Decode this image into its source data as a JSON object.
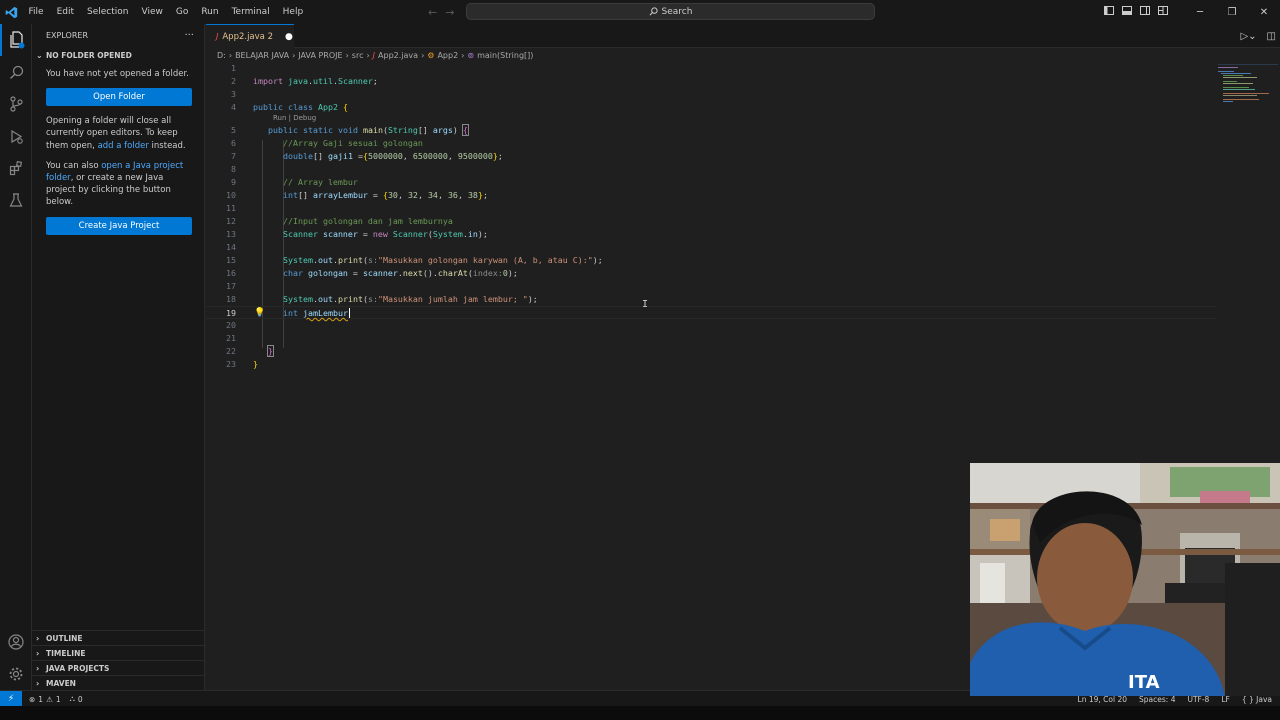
{
  "titlebar": {
    "menu": [
      "File",
      "Edit",
      "Selection",
      "View",
      "Go",
      "Run",
      "Terminal",
      "Help"
    ],
    "search_placeholder": "Search"
  },
  "sidebar": {
    "title": "EXPLORER",
    "section": "NO FOLDER OPENED",
    "msg1": "You have not yet opened a folder.",
    "open_folder_btn": "Open Folder",
    "msg2_a": "Opening a folder will close all currently open editors. To keep them open, ",
    "msg2_link": "add a folder",
    "msg2_b": " instead.",
    "msg3_a": "You can also ",
    "msg3_link": "open a Java project folder",
    "msg3_b": ", or create a new Java project by clicking the button below.",
    "create_java_btn": "Create Java Project",
    "bottom_sections": [
      "OUTLINE",
      "TIMELINE",
      "JAVA PROJECTS",
      "MAVEN"
    ]
  },
  "tab": {
    "icon": "J",
    "label": "App2.java 2"
  },
  "breadcrumb": {
    "parts": [
      "D:",
      "BELAJAR JAVA",
      "JAVA PROJE",
      "src"
    ],
    "file": "App2.java",
    "class": "App2",
    "method": "main(String[])"
  },
  "editor": {
    "codelens": "Run | Debug",
    "current_line": 19,
    "line_count": 23
  },
  "statusbar": {
    "errors": "1",
    "warnings": "1",
    "ports": "0",
    "position": "Ln 19, Col 20",
    "spaces": "Spaces: 4",
    "encoding": "UTF-8",
    "eol": "LF",
    "language": "{ } Java"
  },
  "colors": {
    "accent": "#0078d4",
    "editor_bg": "#1f1f1f",
    "chrome_bg": "#181818"
  }
}
